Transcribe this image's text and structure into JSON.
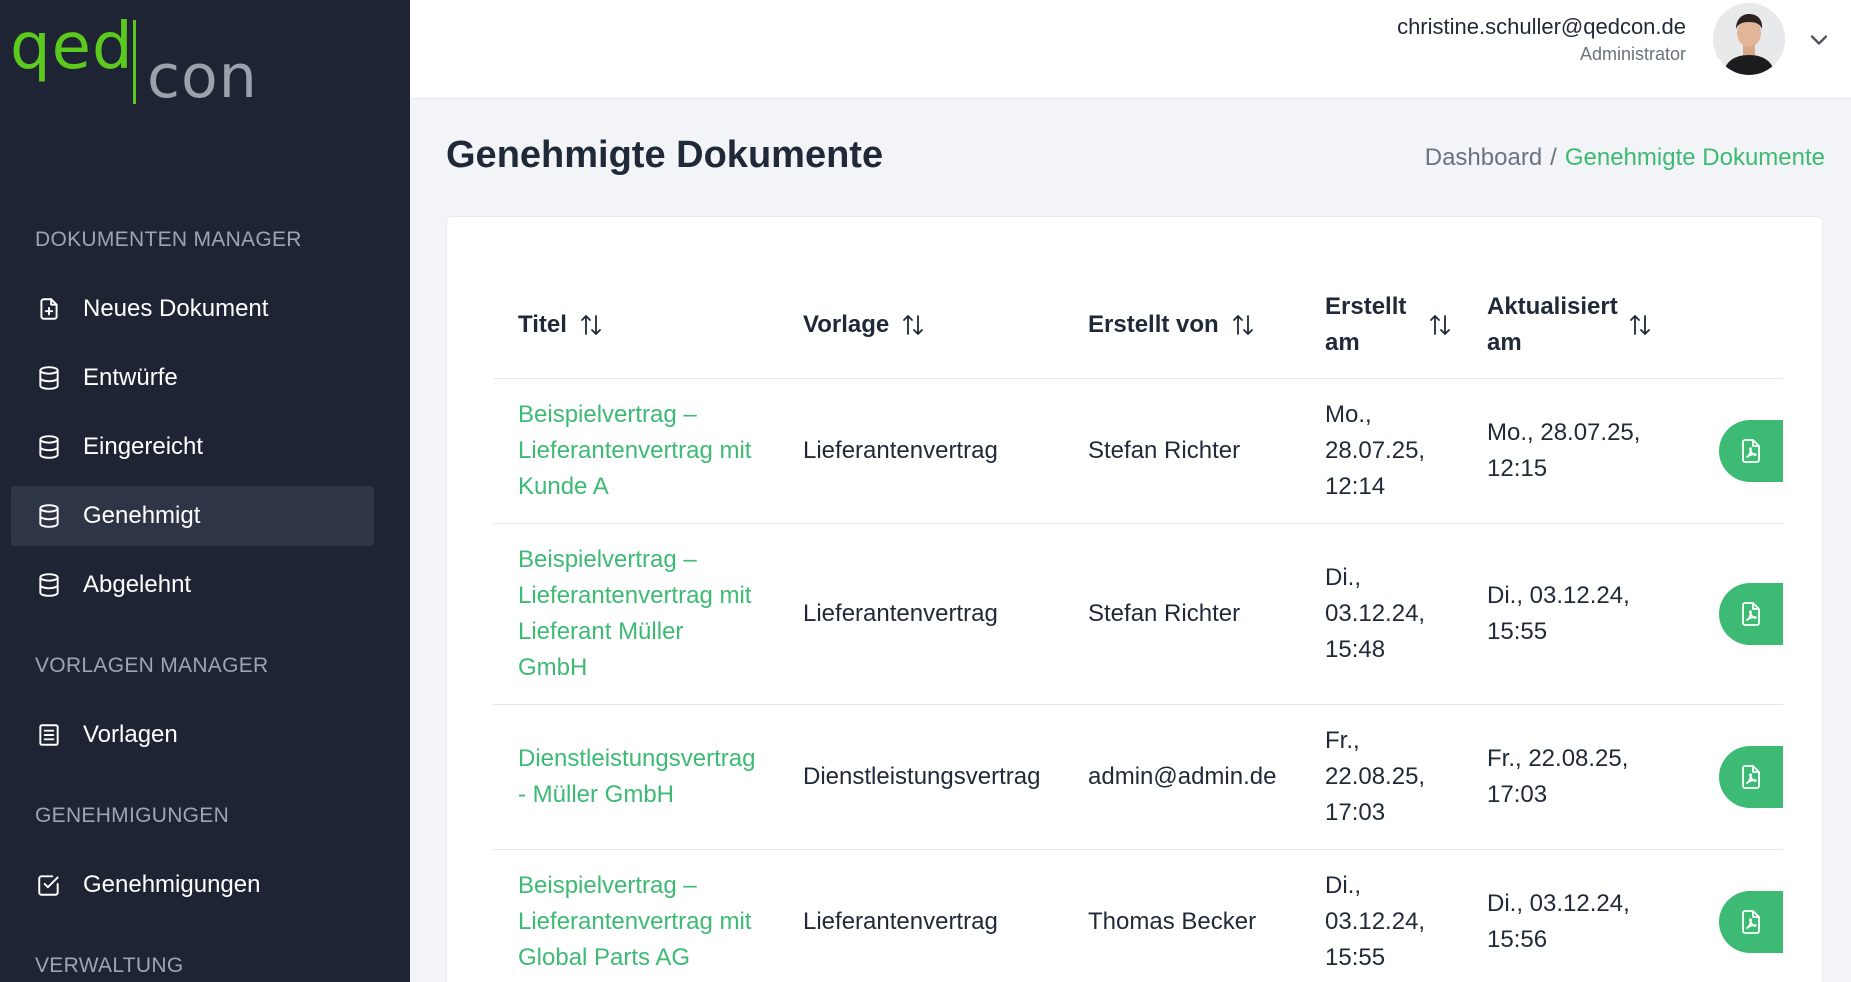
{
  "brand": {
    "logo_left": "qed",
    "logo_right": "con"
  },
  "sidebar": {
    "sections": [
      {
        "title": "DOKUMENTEN MANAGER"
      },
      {
        "title": "VORLAGEN MANAGER"
      },
      {
        "title": "GENEHMIGUNGEN"
      },
      {
        "title": "VERWALTUNG"
      }
    ],
    "items": [
      {
        "label": "Neues Dokument",
        "icon": "file-plus-icon"
      },
      {
        "label": "Entwürfe",
        "icon": "database-icon"
      },
      {
        "label": "Eingereicht",
        "icon": "database-icon"
      },
      {
        "label": "Genehmigt",
        "icon": "database-icon",
        "active": true
      },
      {
        "label": "Abgelehnt",
        "icon": "database-icon"
      },
      {
        "label": "Vorlagen",
        "icon": "list-document-icon"
      },
      {
        "label": "Genehmigungen",
        "icon": "check-square-icon"
      }
    ]
  },
  "user": {
    "email": "christine.schuller@qedcon.de",
    "role": "Administrator"
  },
  "page": {
    "title": "Genehmigte Dokumente",
    "breadcrumb": {
      "home": "Dashboard",
      "separator": "/",
      "current": "Genehmigte Dokumente"
    }
  },
  "table": {
    "headers": {
      "titel": "Titel",
      "vorlage": "Vorlage",
      "erstellt_von": "Erstellt von",
      "erstellt_am_1": "Erstellt",
      "erstellt_am_2": "am",
      "aktualisiert_am_1": "Aktualisiert",
      "aktualisiert_am_2": "am"
    },
    "rows": [
      {
        "title_lines": [
          "Beispielvertrag –",
          "Lieferantenvertrag mit",
          "Kunde A"
        ],
        "vorlage": "Lieferantenvertrag",
        "erstellt_von": "Stefan Richter",
        "erstellt_lines": [
          "Mo.,",
          "28.07.25,",
          "12:14"
        ],
        "aktualisiert_lines": [
          "Mo., 28.07.25,",
          "12:15"
        ]
      },
      {
        "title_lines": [
          "Beispielvertrag –",
          "Lieferantenvertrag mit",
          "Lieferant Müller",
          "GmbH"
        ],
        "vorlage": "Lieferantenvertrag",
        "erstellt_von": "Stefan Richter",
        "erstellt_lines": [
          "Di.,",
          "03.12.24,",
          "15:48"
        ],
        "aktualisiert_lines": [
          "Di., 03.12.24,",
          "15:55"
        ]
      },
      {
        "title_lines": [
          "Dienstleistungsvertrag",
          "- Müller GmbH"
        ],
        "vorlage": "Dienstleistungsvertrag",
        "erstellt_von": "admin@admin.de",
        "erstellt_lines": [
          "Fr.,",
          "22.08.25,",
          "17:03"
        ],
        "aktualisiert_lines": [
          "Fr., 22.08.25,",
          "17:03"
        ]
      },
      {
        "title_lines": [
          "Beispielvertrag –",
          "Lieferantenvertrag mit",
          "Global Parts AG"
        ],
        "vorlage": "Lieferantenvertrag",
        "erstellt_von": "Thomas Becker",
        "erstellt_lines": [
          "Di.,",
          "03.12.24,",
          "15:55"
        ],
        "aktualisiert_lines": [
          "Di., 03.12.24,",
          "15:56"
        ]
      }
    ]
  },
  "colors": {
    "accent": "#3dba73",
    "sidebar_bg": "#1e2433",
    "logo_green": "#5cc91e"
  }
}
